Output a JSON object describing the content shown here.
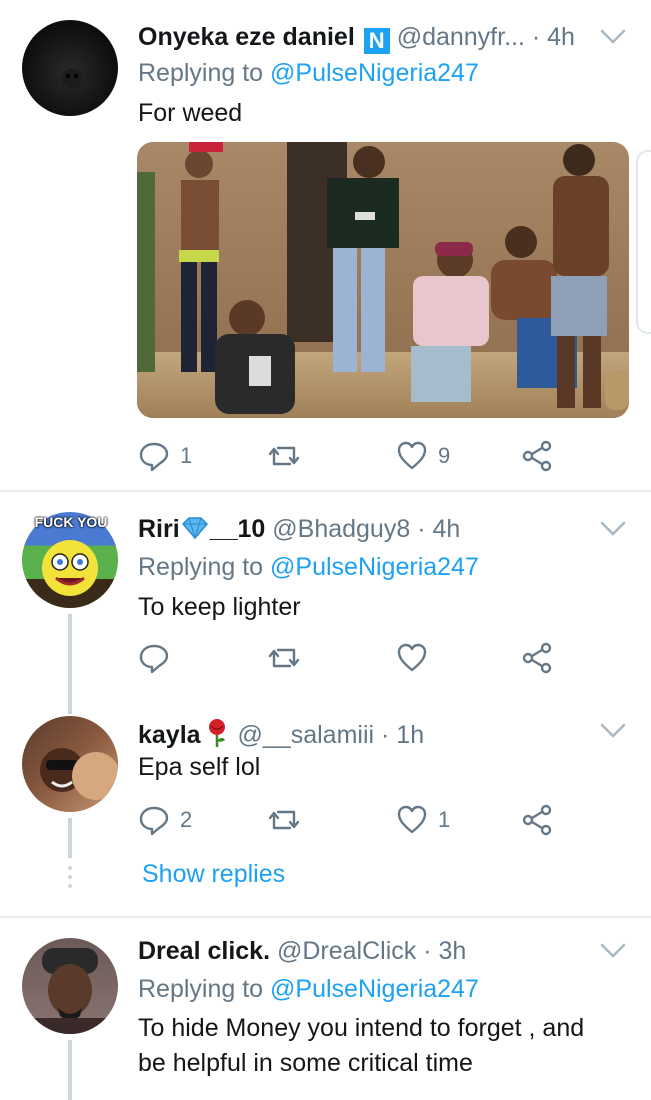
{
  "tweets": [
    {
      "name": "Onyeka eze daniel",
      "badge": "N",
      "handle": "@dannyfr...",
      "time": "· 4h",
      "replying_prefix": "Replying to ",
      "replying_to": "@PulseNigeria247",
      "text": "For weed",
      "replies": "1",
      "retweets": "",
      "likes": "9"
    },
    {
      "name": "Riri",
      "name_suffix": "__10",
      "handle": "@Bhadguy8",
      "time": "· 4h",
      "avatar_label": "FUCK YOU",
      "replying_prefix": "Replying to ",
      "replying_to": "@PulseNigeria247",
      "text": "To keep lighter",
      "replies": "",
      "retweets": "",
      "likes": ""
    },
    {
      "name": "kayla",
      "handle": "@__salamiii",
      "time": "· 1h",
      "text": "Epa self lol",
      "replies": "2",
      "retweets": "",
      "likes": "1",
      "show_replies": "Show replies"
    },
    {
      "name": "Dreal click.",
      "handle": "@DrealClick",
      "time": "· 3h",
      "replying_prefix": "Replying to ",
      "replying_to": "@PulseNigeria247",
      "text_line1": "To hide Money you intend to forget , and",
      "text_line2": "be helpful in some critical time"
    }
  ],
  "colors": {
    "link": "#1da1f2",
    "muted": "#657786",
    "divider": "#e6ecf0"
  }
}
